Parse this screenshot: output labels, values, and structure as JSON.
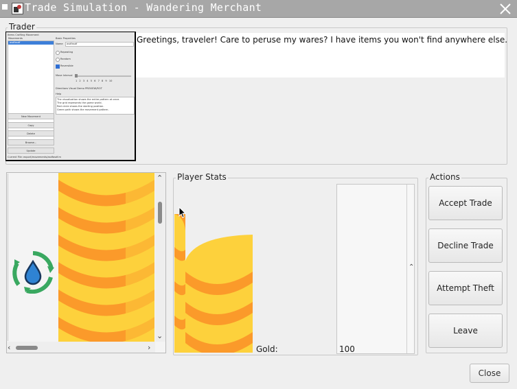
{
  "window": {
    "title": "Trade Simulation - Wandering Merchant",
    "titlebar_color": "#a7a7a7"
  },
  "trader": {
    "group_label": "Trader",
    "greeting": "Greetings, traveler! Care to peruse my wares? I have items you won't find anywhere else.",
    "screenshot": {
      "tabs": "Items  Crafting  Movement",
      "list_header": "Movements",
      "selected_item": "asdfasdf",
      "props_header": "Basic Properties",
      "name_label": "Name",
      "name_value": "asdfasdf",
      "opt1": "Repeating",
      "opt2": "Random",
      "opt3": "Reversible",
      "move_interval_label": "Move Interval",
      "ticks": [
        "1",
        "2",
        "3",
        "4",
        "5",
        "6",
        "7",
        "8",
        "9",
        "10"
      ],
      "tab_row": "Directions  Visual Demo  PREVIEW/ROT",
      "help_title": "Help",
      "help_lines": [
        "The visualization shows the entire pattern at once.",
        "The grid represents the game world.",
        "Red circle shows the starting position.",
        "Green path shows the movement pattern."
      ],
      "buttons": [
        "New Movement",
        "Copy",
        "Delete",
        "Browse...",
        "Update"
      ],
      "status": "Current File: export/movements/asdfasdf.m"
    }
  },
  "player_stats": {
    "group_label": "Player Stats",
    "gold_label": "Gold:",
    "gold_value": "100"
  },
  "actions": {
    "group_label": "Actions",
    "accept": "Accept Trade",
    "decline": "Decline Trade",
    "theft": "Attempt Theft",
    "leave": "Leave"
  },
  "footer": {
    "close": "Close"
  },
  "icons": {
    "water_recycle": "water-recycle-icon",
    "coins": "gold-coins-icon"
  },
  "colors": {
    "coin_light": "#fdd13c",
    "coin_dark": "#fb9a2a",
    "recycle_green": "#39a860",
    "water_blue": "#2f83d3"
  }
}
